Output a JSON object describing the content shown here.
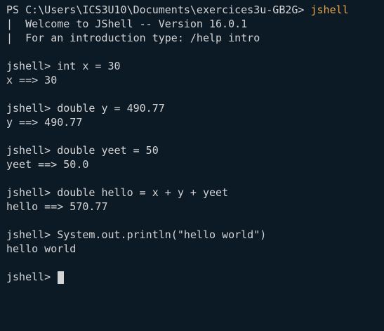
{
  "prompt_line": {
    "path": "PS C:\\Users\\ICS3U10\\Documents\\exercices3u-GB2G> ",
    "command": "jshell"
  },
  "banner": [
    "|  Welcome to JShell -- Version 16.0.1",
    "|  For an introduction type: /help intro"
  ],
  "session": [
    {
      "input": "jshell> int x = 30",
      "output": "x ==> 30"
    },
    {
      "input": "jshell> double y = 490.77",
      "output": "y ==> 490.77"
    },
    {
      "input": "jshell> double yeet = 50",
      "output": "yeet ==> 50.0"
    },
    {
      "input": "jshell> double hello = x + y + yeet",
      "output": "hello ==> 570.77"
    },
    {
      "input": "jshell> System.out.println(\"hello world\")",
      "output": "hello world"
    }
  ],
  "current_prompt": "jshell> ",
  "colors": {
    "background": "#0c1a26",
    "text": "#d4d4d4",
    "command_highlight": "#e5a64b"
  }
}
